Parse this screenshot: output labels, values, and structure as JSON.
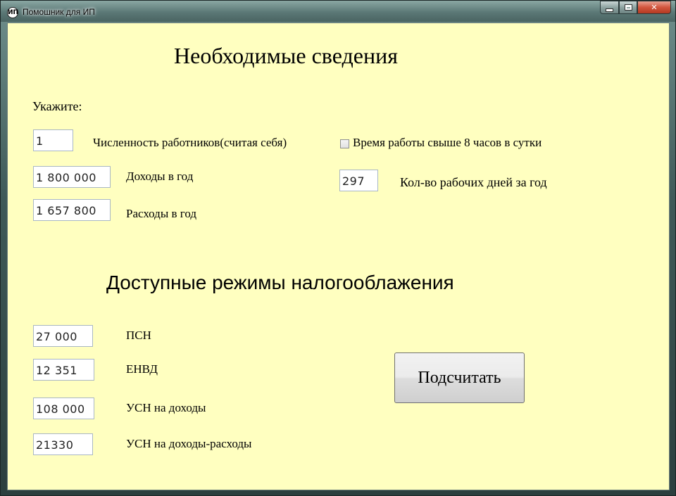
{
  "window": {
    "title": "Помошник для ИП",
    "icon": "app-icon",
    "icon_glyph": "ИП",
    "close_glyph": "✕"
  },
  "form": {
    "heading": "Необходимые сведения",
    "prompt": "Укажите:",
    "employees": {
      "value": "1",
      "label": "Численность работников(считая себя)"
    },
    "income": {
      "value": "1 800 000",
      "label": "Доходы  в год"
    },
    "expenses": {
      "value": "1 657 800",
      "label": "Расходы в год"
    },
    "overtime_checkbox": {
      "label": "Время работы свыше 8 часов в сутки",
      "checked": false
    },
    "workdays": {
      "value": "297",
      "label": "Кол-во рабочих дней за год"
    }
  },
  "regimes": {
    "heading": "Доступные режимы налогооблажения",
    "items": [
      {
        "value": "27 000",
        "label": "ПСН"
      },
      {
        "value": "12 351",
        "label": "ЕНВД"
      },
      {
        "value": "108 000",
        "label": "УСН на доходы"
      },
      {
        "value": "21330",
        "label": "УСН на доходы-расходы"
      }
    ]
  },
  "calculate_button": {
    "label": "Подсчитать"
  },
  "colors": {
    "client_background": "#ffffc0",
    "field_border": "#a9b7c4"
  }
}
